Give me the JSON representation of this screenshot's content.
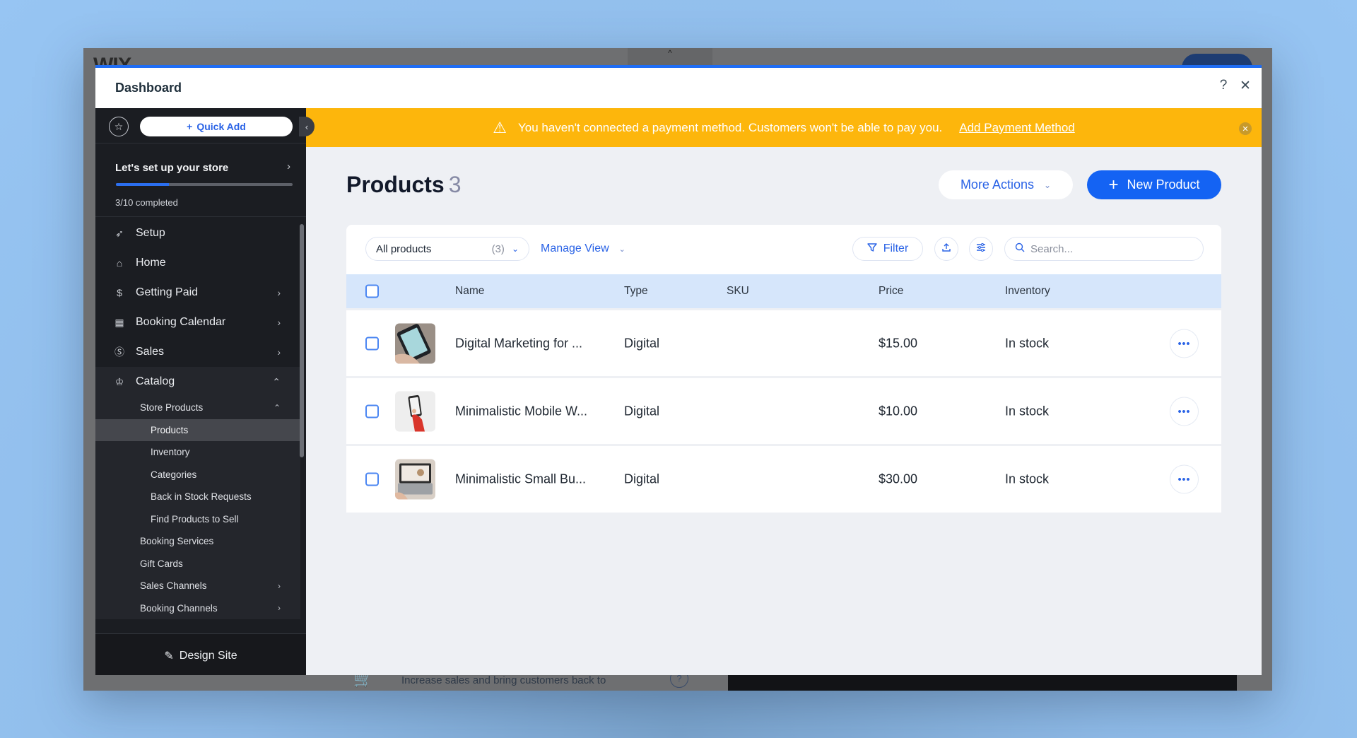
{
  "editor": {
    "logo": "WIX",
    "promo_text": "Increase sales and bring customers back to",
    "promo_help": "?"
  },
  "modal": {
    "title": "Dashboard",
    "help_icon": "?",
    "close_icon": "✕"
  },
  "sidebar": {
    "quick_add_label": "Quick Add",
    "setup": {
      "title": "Let's set up your store",
      "progress_fraction": 0.3,
      "status": "3/10 completed"
    },
    "items": [
      {
        "label": "Setup",
        "icon": "rocket-icon",
        "glyph": "🚀",
        "chevron": ""
      },
      {
        "label": "Home",
        "icon": "home-icon",
        "glyph": "⌂",
        "chevron": ""
      },
      {
        "label": "Getting Paid",
        "icon": "payment-icon",
        "glyph": "$",
        "chevron": "›"
      },
      {
        "label": "Booking Calendar",
        "icon": "calendar-icon",
        "glyph": "▦",
        "chevron": "›"
      },
      {
        "label": "Sales",
        "icon": "dollar-circle-icon",
        "glyph": "Ⓢ",
        "chevron": "›"
      },
      {
        "label": "Catalog",
        "icon": "catalog-icon",
        "glyph": "♔",
        "chevron": "⌃"
      }
    ],
    "catalog_children": {
      "store_products": "Store Products",
      "store_products_children": [
        "Products",
        "Inventory",
        "Categories",
        "Back in Stock Requests",
        "Find Products to Sell"
      ],
      "others": [
        {
          "label": "Booking Services",
          "chevron": ""
        },
        {
          "label": "Gift Cards",
          "chevron": ""
        },
        {
          "label": "Sales Channels",
          "chevron": "›"
        },
        {
          "label": "Booking Channels",
          "chevron": "›"
        }
      ]
    },
    "active_item": "Products",
    "footer_label": "Design Site"
  },
  "banner": {
    "message": "You haven't connected a payment method. Customers won't be able to pay you.",
    "link": "Add Payment Method",
    "color": "#fdb60c"
  },
  "page": {
    "title": "Products",
    "count": "3",
    "more_actions_label": "More Actions",
    "new_product_label": "New Product",
    "accent": "#1463f3"
  },
  "toolbar": {
    "view_select": "All products",
    "view_count": "(3)",
    "manage_view": "Manage View",
    "filter": "Filter",
    "search_placeholder": "Search..."
  },
  "table": {
    "columns": [
      "Name",
      "Type",
      "SKU",
      "Price",
      "Inventory"
    ],
    "rows": [
      {
        "name": "Digital Marketing for ...",
        "type": "Digital",
        "sku": "",
        "price": "$15.00",
        "inventory": "In stock",
        "thumb": "tablet"
      },
      {
        "name": "Minimalistic Mobile W...",
        "type": "Digital",
        "sku": "",
        "price": "$10.00",
        "inventory": "In stock",
        "thumb": "phone"
      },
      {
        "name": "Minimalistic Small Bu...",
        "type": "Digital",
        "sku": "",
        "price": "$30.00",
        "inventory": "In stock",
        "thumb": "laptop"
      }
    ],
    "row_action": "•••"
  }
}
